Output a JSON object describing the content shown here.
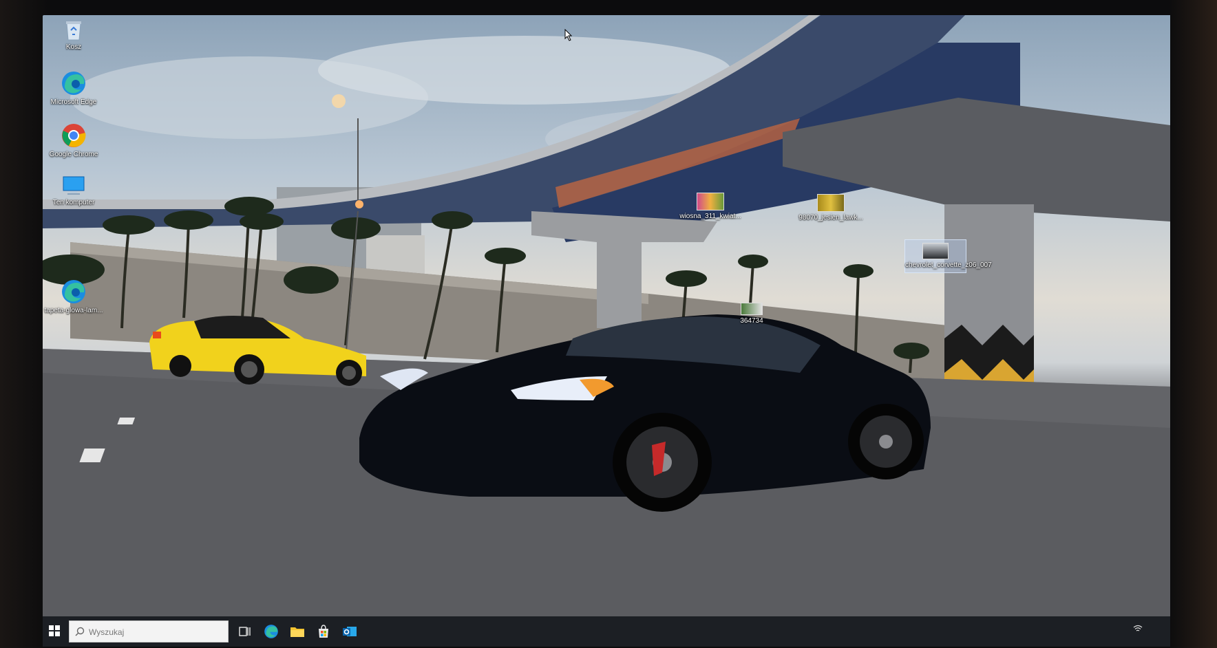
{
  "desktop": {
    "icons": [
      {
        "label": "Kosz",
        "icon": "recycle-bin-icon"
      },
      {
        "label": "Microsoft Edge",
        "icon": "edge-icon"
      },
      {
        "label": "Google Chrome",
        "icon": "chrome-icon"
      },
      {
        "label": "Ten komputer",
        "icon": "computer-icon"
      },
      {
        "label": "tapeta-glowa-lam...",
        "icon": "edge-icon"
      }
    ],
    "files": [
      {
        "label": "wiosna_311_kwiat..."
      },
      {
        "label": "98070_jesien_lawk..."
      },
      {
        "label": "364734"
      },
      {
        "label": "chevrolet_corvette_z06_007"
      }
    ]
  },
  "taskbar": {
    "search_placeholder": "Wyszukaj",
    "items": [
      "task-view-icon",
      "edge-icon",
      "file-explorer-icon",
      "store-icon",
      "outlook-icon"
    ]
  },
  "colors": {
    "taskbar": "#1c1f24",
    "accent": "#0078d4"
  }
}
